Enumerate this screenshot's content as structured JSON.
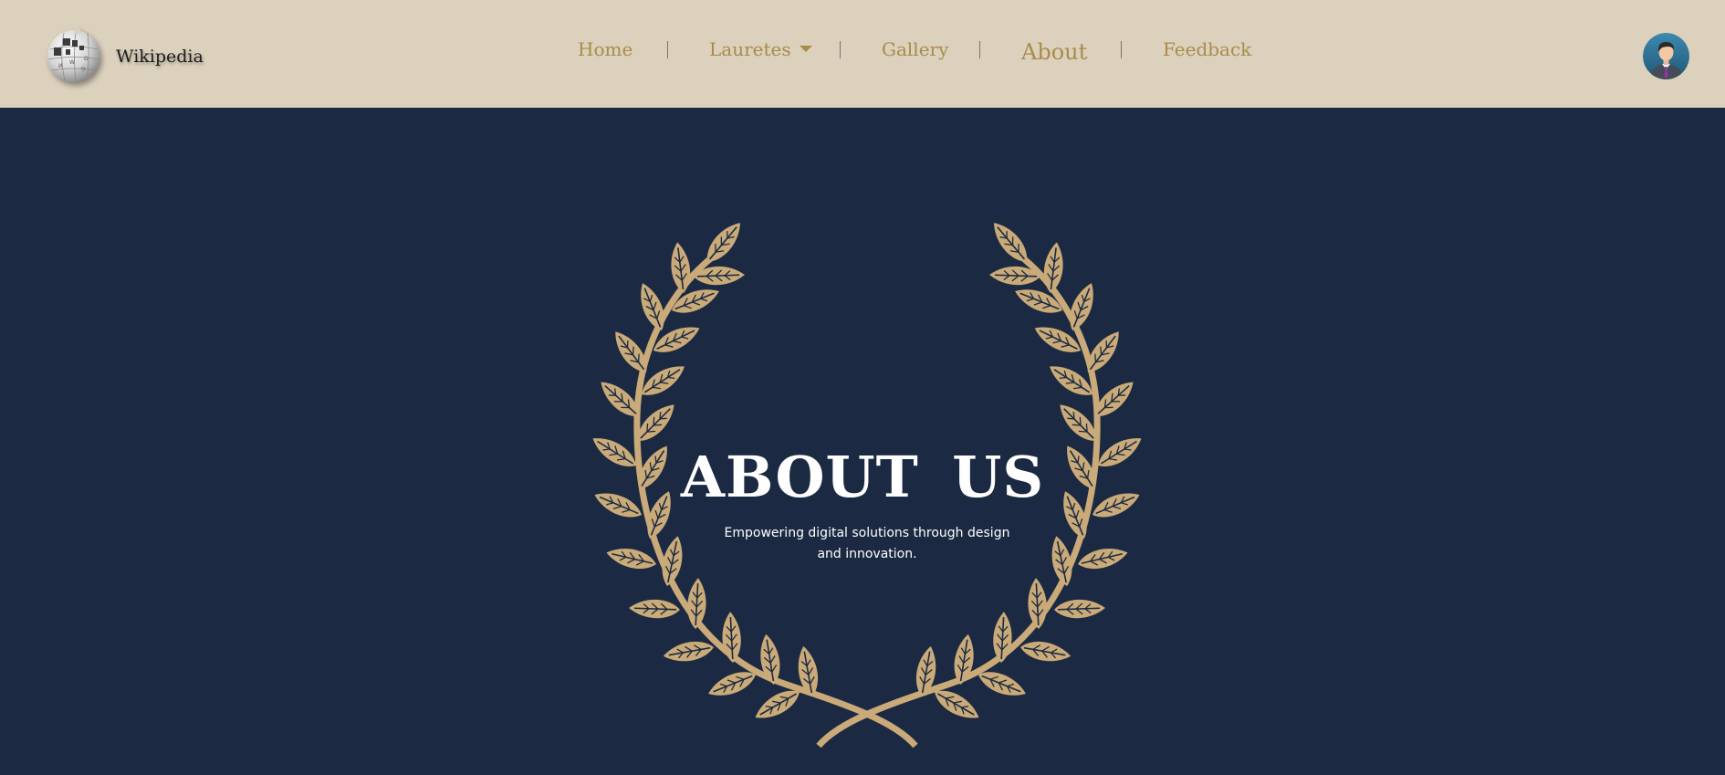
{
  "brand": {
    "name": "Wikipedia",
    "logo_icon": "wikipedia-globe-icon"
  },
  "nav": {
    "home": "Home",
    "laureates": "Lauretes",
    "gallery": "Gallery",
    "about": "About",
    "feedback": "Feedback",
    "active": "About"
  },
  "user": {
    "avatar_icon": "user-avatar-icon"
  },
  "hero": {
    "title": "ABOUT  US",
    "subtitle": "Empowering digital solutions through design and innovation.",
    "decoration_icon": "laurel-wreath-icon"
  },
  "colors": {
    "nav_background": "#dcd1bd",
    "nav_link": "#a98b4a",
    "hero_background": "#1b2a42",
    "laurel": "#c9aa78",
    "title": "#ffffff"
  }
}
